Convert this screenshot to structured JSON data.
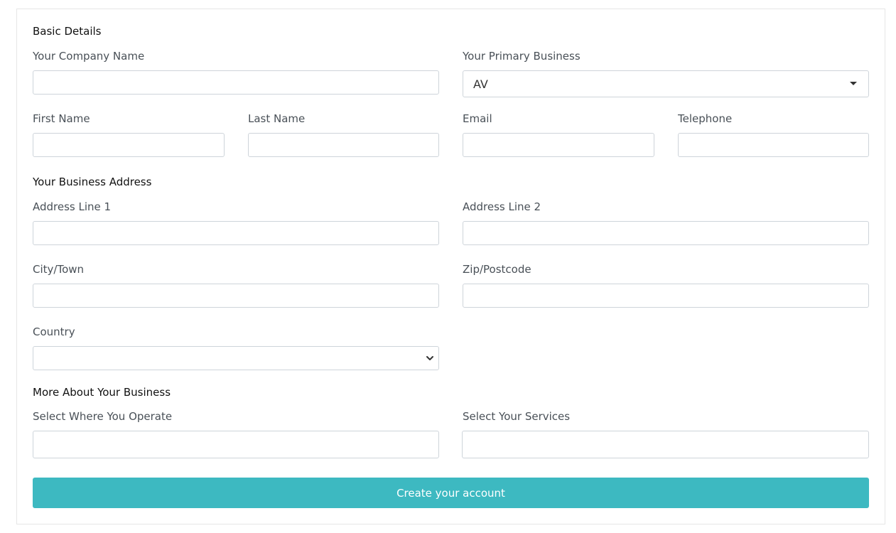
{
  "sections": {
    "basic": "Basic Details",
    "address": "Your Business Address",
    "more": "More About Your Business"
  },
  "fields": {
    "company_name": {
      "label": "Your Company Name",
      "value": ""
    },
    "primary_business": {
      "label": "Your Primary Business",
      "value": "AV"
    },
    "first_name": {
      "label": "First Name",
      "value": ""
    },
    "last_name": {
      "label": "Last Name",
      "value": ""
    },
    "email": {
      "label": "Email",
      "value": ""
    },
    "telephone": {
      "label": "Telephone",
      "value": ""
    },
    "address1": {
      "label": "Address Line 1",
      "value": ""
    },
    "address2": {
      "label": "Address Line 2",
      "value": ""
    },
    "city": {
      "label": "City/Town",
      "value": ""
    },
    "zip": {
      "label": "Zip/Postcode",
      "value": ""
    },
    "country": {
      "label": "Country",
      "value": ""
    },
    "operate": {
      "label": "Select Where You Operate",
      "value": ""
    },
    "services": {
      "label": "Select Your Services",
      "value": ""
    }
  },
  "submit": {
    "label": "Create your account"
  },
  "colors": {
    "accent": "#3db9c1",
    "border": "#ced4da",
    "card_border": "#e6e6e6"
  },
  "icons": {
    "primary_business_caret": "caret-down-icon",
    "country_chevron": "chevron-down-icon"
  }
}
